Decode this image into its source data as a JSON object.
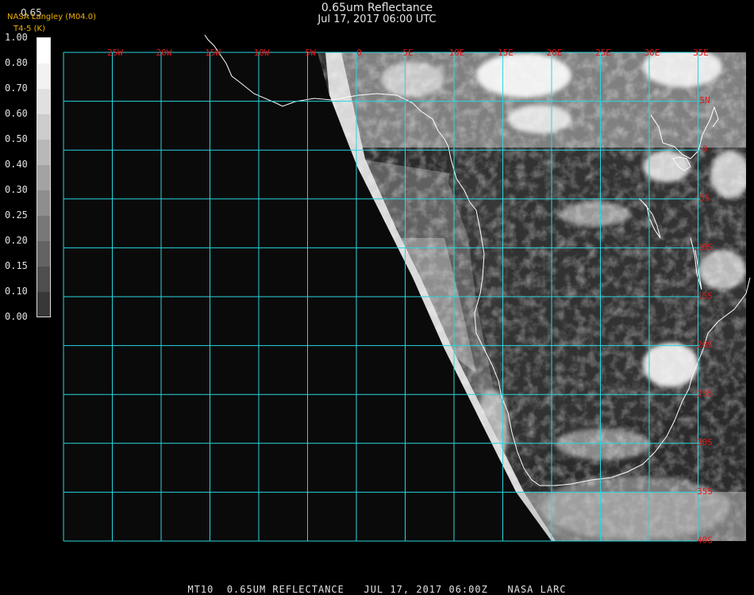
{
  "header": {
    "title": "0.65um Reflectance",
    "subtitle": "Jul 17, 2017 06:00 UTC"
  },
  "credit": {
    "line1": "NASA Langley (M04.0)",
    "line2": "T4-5 (K)"
  },
  "colorbar": {
    "top_label": "0.65",
    "ticks": [
      "1.00",
      "0.80",
      "0.70",
      "0.60",
      "0.50",
      "0.40",
      "0.30",
      "0.25",
      "0.20",
      "0.15",
      "0.10",
      "0.00"
    ],
    "shades": [
      "#ffffff",
      "#f2f2f2",
      "#e0e0e0",
      "#cccccc",
      "#b8b8b8",
      "#a3a3a3",
      "#8e8e8e",
      "#787878",
      "#636363",
      "#4e4e4e",
      "#383838",
      "#000000"
    ]
  },
  "map": {
    "grid_color": "#29d6e0",
    "label_color": "#e01818",
    "lon_labels": [
      "25W",
      "20W",
      "15W",
      "10W",
      "5W",
      "0",
      "5E",
      "10E",
      "15E",
      "20E",
      "25E",
      "30E",
      "35E"
    ],
    "lat_labels": [
      "5N",
      "0",
      "5S",
      "10S",
      "15S",
      "20S",
      "25S",
      "30S",
      "35S",
      "40S"
    ]
  },
  "footer": {
    "text": "MT10  0.65UM REFLECTANCE   JUL 17, 2017 06:00Z   NASA LARC"
  }
}
